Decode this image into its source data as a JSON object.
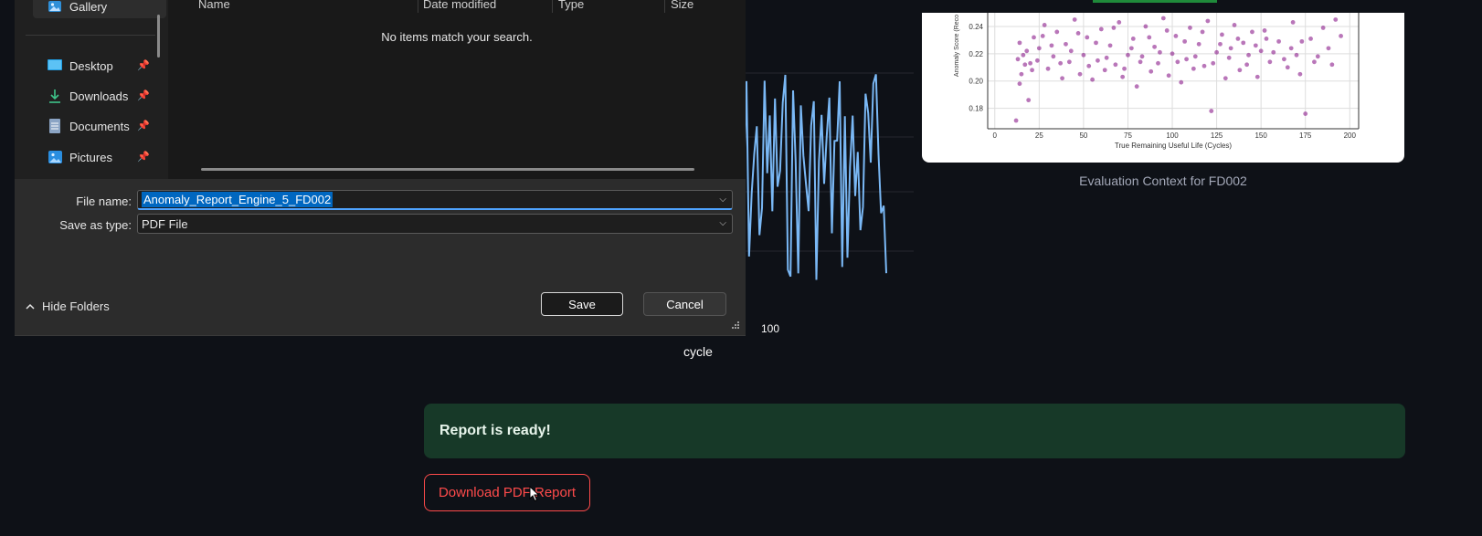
{
  "dialog": {
    "nav": {
      "gallery": "Gallery",
      "items": [
        {
          "label": "Desktop",
          "icon": "desktop-icon"
        },
        {
          "label": "Downloads",
          "icon": "download-icon"
        },
        {
          "label": "Documents",
          "icon": "document-icon"
        },
        {
          "label": "Pictures",
          "icon": "pictures-icon"
        }
      ]
    },
    "columns": {
      "name": "Name",
      "date": "Date modified",
      "type": "Type",
      "size": "Size"
    },
    "empty_message": "No items match your search.",
    "file_name_label": "File name:",
    "file_name_value": "Anomaly_Report_Engine_5_FD002",
    "save_type_label": "Save as type:",
    "save_type_value": "PDF File",
    "hide_folders": "Hide Folders",
    "save_label": "Save",
    "cancel_label": "Cancel"
  },
  "app": {
    "line_chart": {
      "tick_label": "100",
      "xlabel": "cycle",
      "color": "#7ab8f5"
    },
    "scatter_caption": "Evaluation Context for FD002",
    "alert_text": "Report is ready!",
    "download_label": "Download PDF Report"
  },
  "chart_data": {
    "type": "scatter",
    "xlabel": "True Remaining Useful Life (Cycles)",
    "ylabel": "Anomaly Score (Reco",
    "x_ticks": [
      "0",
      "25",
      "50",
      "75",
      "100",
      "125",
      "150",
      "175",
      "200"
    ],
    "y_ticks": [
      "0.18",
      "0.20",
      "0.22",
      "0.24"
    ],
    "xlim": [
      -4,
      205
    ],
    "ylim": [
      0.165,
      0.25
    ],
    "grid": true,
    "color": "#8b1a8b",
    "points": [
      [
        13,
        0.216
      ],
      [
        15,
        0.205
      ],
      [
        17,
        0.212
      ],
      [
        18,
        0.222
      ],
      [
        12,
        0.171
      ],
      [
        20,
        0.213
      ],
      [
        22,
        0.232
      ],
      [
        25,
        0.224
      ],
      [
        14,
        0.198
      ],
      [
        19,
        0.186
      ],
      [
        28,
        0.241
      ],
      [
        30,
        0.209
      ],
      [
        33,
        0.218
      ],
      [
        35,
        0.236
      ],
      [
        38,
        0.202
      ],
      [
        40,
        0.227
      ],
      [
        42,
        0.214
      ],
      [
        45,
        0.245
      ],
      [
        48,
        0.205
      ],
      [
        50,
        0.219
      ],
      [
        52,
        0.232
      ],
      [
        55,
        0.201
      ],
      [
        58,
        0.215
      ],
      [
        60,
        0.238
      ],
      [
        62,
        0.208
      ],
      [
        65,
        0.226
      ],
      [
        68,
        0.212
      ],
      [
        70,
        0.243
      ],
      [
        72,
        0.203
      ],
      [
        75,
        0.219
      ],
      [
        78,
        0.231
      ],
      [
        80,
        0.196
      ],
      [
        82,
        0.214
      ],
      [
        85,
        0.24
      ],
      [
        88,
        0.207
      ],
      [
        90,
        0.225
      ],
      [
        92,
        0.213
      ],
      [
        95,
        0.246
      ],
      [
        98,
        0.204
      ],
      [
        100,
        0.22
      ],
      [
        102,
        0.233
      ],
      [
        105,
        0.199
      ],
      [
        108,
        0.216
      ],
      [
        110,
        0.239
      ],
      [
        112,
        0.209
      ],
      [
        115,
        0.227
      ],
      [
        118,
        0.211
      ],
      [
        120,
        0.244
      ],
      [
        122,
        0.178
      ],
      [
        125,
        0.221
      ],
      [
        128,
        0.234
      ],
      [
        130,
        0.202
      ],
      [
        132,
        0.217
      ],
      [
        135,
        0.241
      ],
      [
        138,
        0.208
      ],
      [
        140,
        0.228
      ],
      [
        142,
        0.212
      ],
      [
        145,
        0.236
      ],
      [
        148,
        0.203
      ],
      [
        150,
        0.222
      ],
      [
        152,
        0.237
      ],
      [
        155,
        0.214
      ],
      [
        160,
        0.229
      ],
      [
        165,
        0.21
      ],
      [
        168,
        0.243
      ],
      [
        170,
        0.219
      ],
      [
        172,
        0.205
      ],
      [
        175,
        0.176
      ],
      [
        178,
        0.231
      ],
      [
        182,
        0.218
      ],
      [
        185,
        0.239
      ],
      [
        188,
        0.224
      ],
      [
        190,
        0.212
      ],
      [
        192,
        0.245
      ],
      [
        195,
        0.233
      ],
      [
        14,
        0.228
      ],
      [
        16,
        0.219
      ],
      [
        21,
        0.208
      ],
      [
        24,
        0.215
      ],
      [
        27,
        0.233
      ],
      [
        32,
        0.226
      ],
      [
        37,
        0.213
      ],
      [
        43,
        0.222
      ],
      [
        47,
        0.235
      ],
      [
        53,
        0.211
      ],
      [
        57,
        0.228
      ],
      [
        63,
        0.217
      ],
      [
        67,
        0.239
      ],
      [
        73,
        0.209
      ],
      [
        77,
        0.224
      ],
      [
        83,
        0.218
      ],
      [
        87,
        0.232
      ],
      [
        93,
        0.221
      ],
      [
        97,
        0.237
      ],
      [
        103,
        0.214
      ],
      [
        107,
        0.229
      ],
      [
        113,
        0.218
      ],
      [
        117,
        0.236
      ],
      [
        123,
        0.213
      ],
      [
        127,
        0.227
      ],
      [
        133,
        0.224
      ],
      [
        137,
        0.231
      ],
      [
        143,
        0.219
      ],
      [
        147,
        0.226
      ],
      [
        153,
        0.231
      ],
      [
        157,
        0.221
      ],
      [
        163,
        0.216
      ],
      [
        167,
        0.224
      ],
      [
        173,
        0.229
      ],
      [
        180,
        0.214
      ]
    ]
  }
}
